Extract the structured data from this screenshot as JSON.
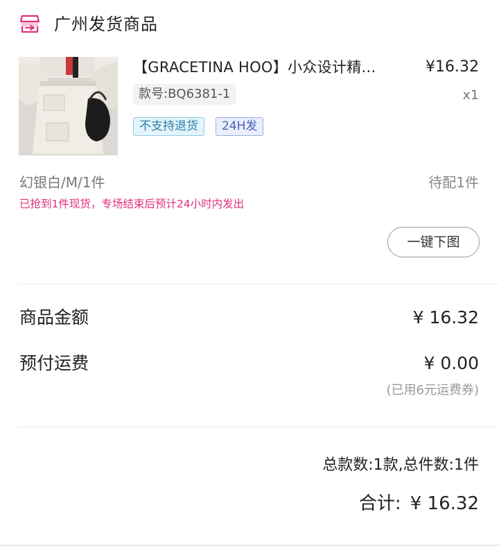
{
  "shop": {
    "icon": "shop-store-icon",
    "icon_color": "#e0307a",
    "title": "广州发货商品"
  },
  "product": {
    "image": "tweed-skirt-product-photo",
    "name": "【GRACETINA HOO】小众设计精...",
    "price": "¥16.32",
    "sku": "款号:BQ6381-1",
    "quantity": "x1",
    "tags": [
      "不支持退货",
      "24H发"
    ],
    "variant": "幻银白/M/1件",
    "status": "待配1件",
    "notice": "已抢到1件现货，专场结束后预计24小时内发出",
    "notice_color": "#e0307a",
    "download_button": "一键下图"
  },
  "fees": {
    "goods_label": "商品金额",
    "goods_value": "¥ 16.32",
    "shipping_label": "预付运费",
    "shipping_value": "¥ 0.00",
    "coupon_note": "(已用6元运费券)"
  },
  "summary": {
    "counts": "总款数:1款,总件数:1件",
    "total_label": "合计:",
    "total_value": "¥ 16.32"
  }
}
